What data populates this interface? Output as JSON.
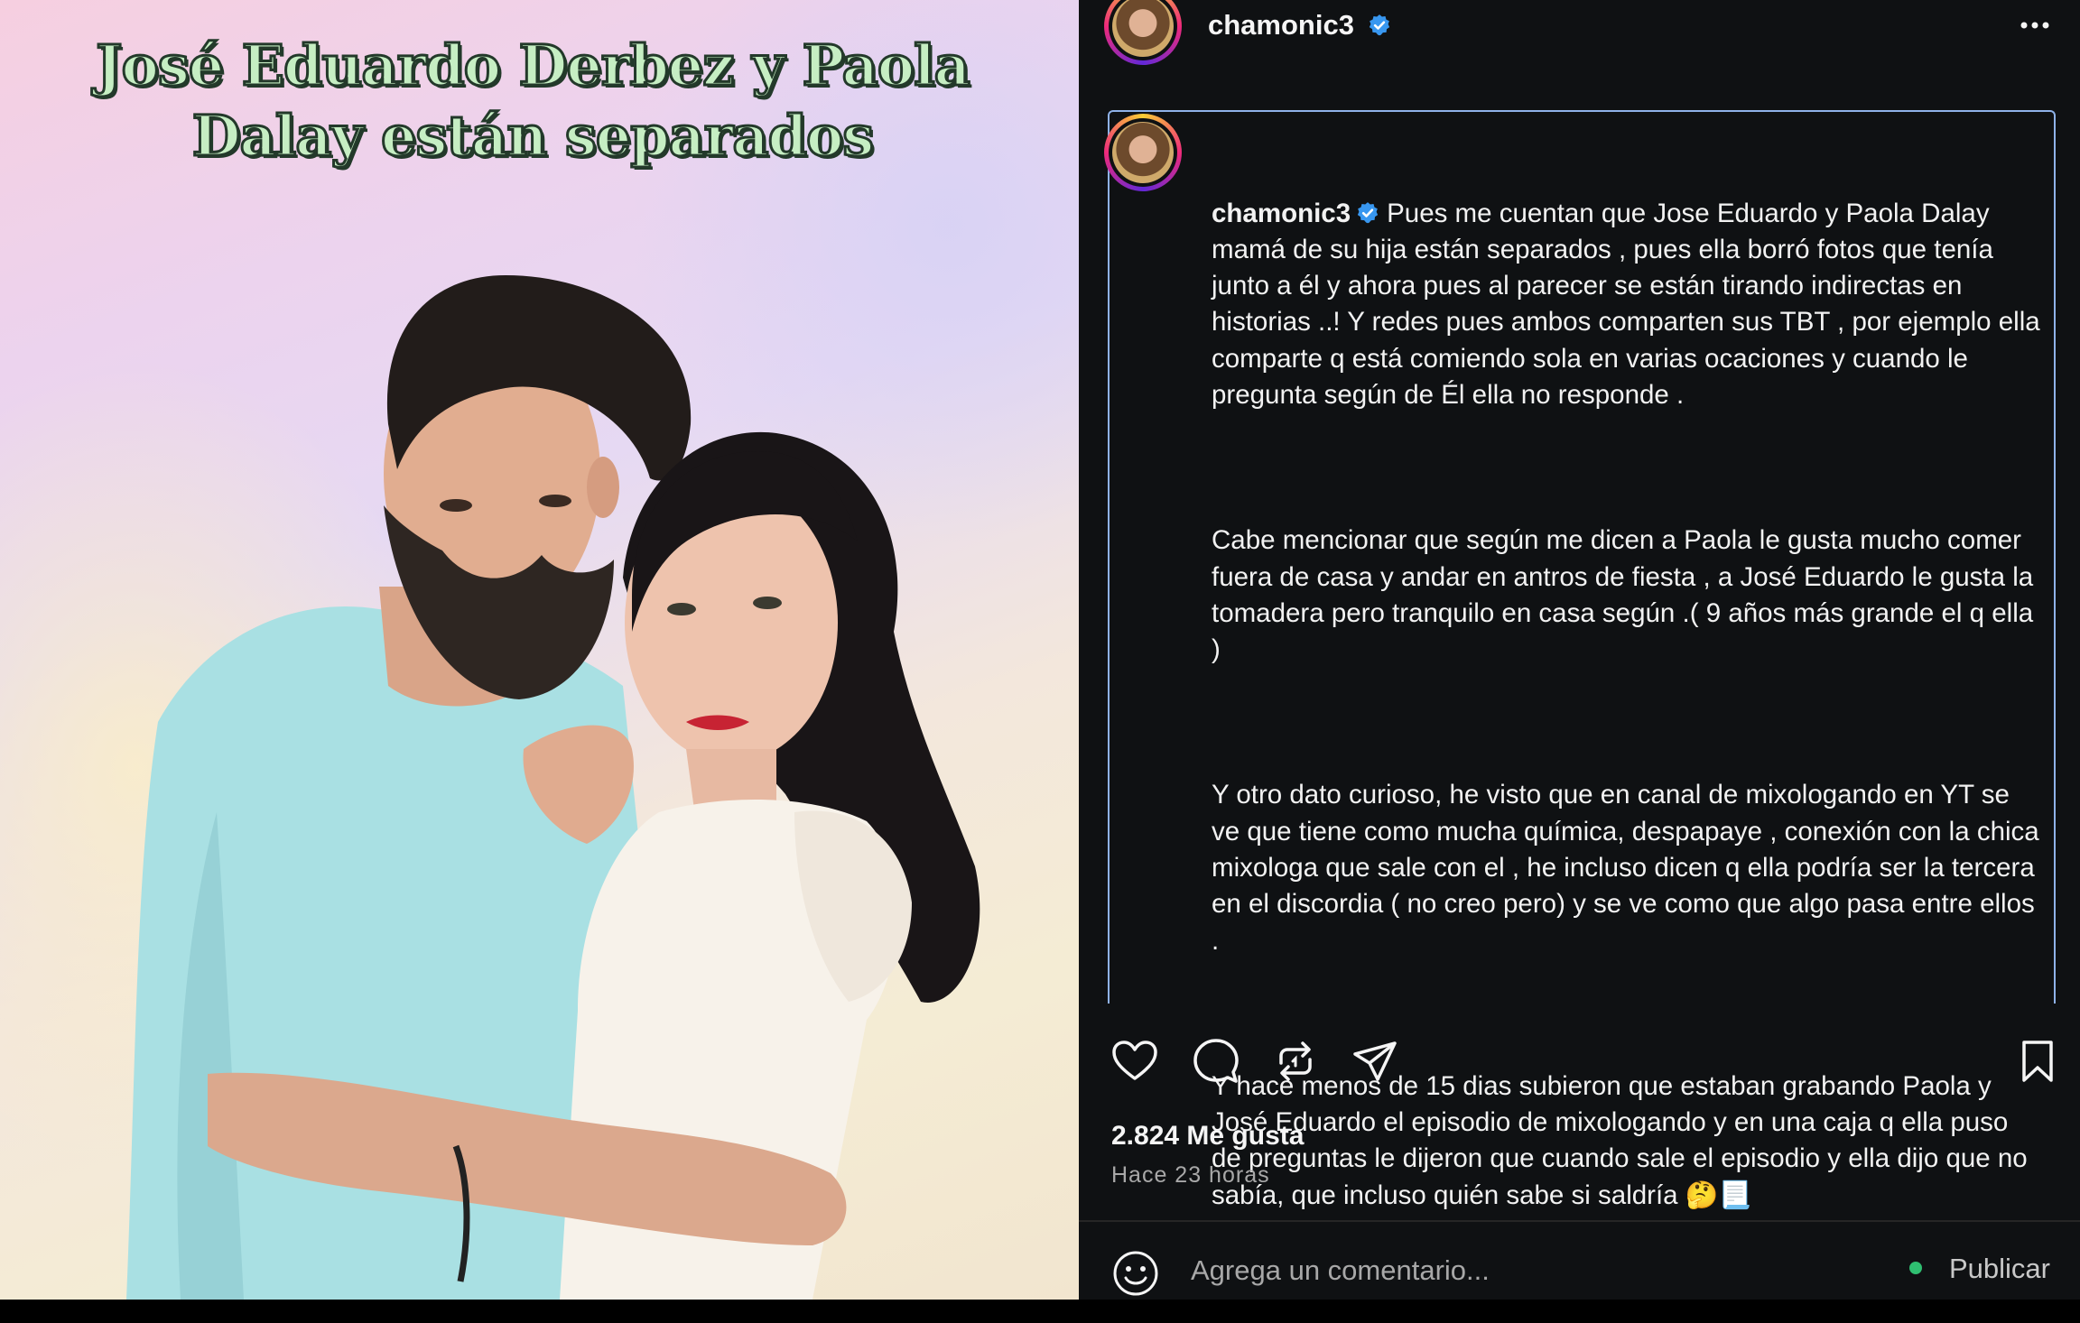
{
  "image": {
    "headline": "José Eduardo Derbez y Paola\nDalay están separados"
  },
  "post": {
    "username": "chamonic3",
    "verified": true,
    "caption_paragraphs": [
      "Pues me cuentan que Jose Eduardo y Paola Dalay mamá de su hija están separados , pues ella borró fotos que tenía junto a él y ahora pues al parecer se están tirando indirectas en historias ..! Y redes pues ambos comparten sus TBT , por ejemplo ella comparte q está comiendo sola en varias ocaciones y cuando le pregunta según de Él ella no responde .",
      "Cabe mencionar que según me dicen a Paola le gusta mucho comer fuera de casa y andar en antros de fiesta , a José Eduardo le gusta la tomadera pero tranquilo en casa según .( 9 años más grande el q ella )",
      "Y otro dato curioso, he visto que en canal de mixologando en YT se ve que tiene como mucha química, despapaye , conexión con la chica mixologa que sale con el , he incluso dicen q ella podría ser la tercera en el discordia ( no creo pero) y se ve como que algo pasa entre ellos .",
      "Y hace menos de 15 dias subieron que estaban grabando Paola y José Eduardo el episodio de mixologando y en una caja q ella puso de preguntas le dijeron que cuando sale el episodio y ella dijo que no sabía, que incluso quién sabe si saldría 🤔📃"
    ],
    "likes": "2.824 Me gusta",
    "time_ago": "Hace 23 horas",
    "comment_placeholder": "Agrega un comentario...",
    "publish_label": "Publicar",
    "colors": {
      "panel_bg": "#0f1113",
      "verified_blue": "#3897f0",
      "caption_border": "#8fb2e9",
      "status_green": "#2fbf71"
    },
    "icons": [
      "more-icon",
      "heart-icon",
      "comment-icon",
      "repost-icon",
      "share-icon",
      "bookmark-icon",
      "emoji-icon"
    ]
  }
}
